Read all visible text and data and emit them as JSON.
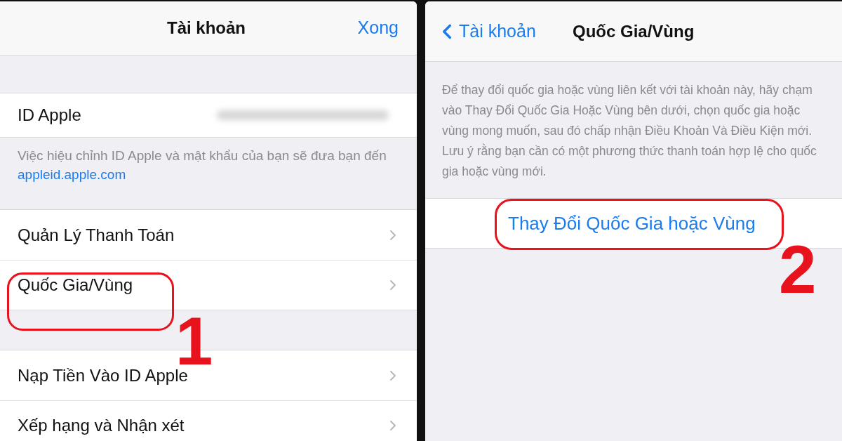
{
  "left_screen": {
    "nav": {
      "title": "Tài khoản",
      "action": "Xong"
    },
    "apple_id": {
      "label": "ID Apple"
    },
    "apple_id_note": {
      "text": "Việc hiệu chỉnh ID Apple và mật khẩu của bạn sẽ đưa bạn đến ",
      "link": "appleid.apple.com"
    },
    "groups": [
      [
        {
          "label": "Quản Lý Thanh Toán"
        },
        {
          "label": "Quốc Gia/Vùng"
        }
      ],
      [
        {
          "label": "Nạp Tiền Vào ID Apple"
        },
        {
          "label": "Xếp hạng và Nhận xét"
        }
      ]
    ]
  },
  "right_screen": {
    "nav": {
      "back": "Tài khoản",
      "title": "Quốc Gia/Vùng"
    },
    "description": "Để thay đổi quốc gia hoặc vùng liên kết với tài khoản này, hãy chạm vào Thay Đổi Quốc Gia Hoặc Vùng bên dưới, chọn quốc gia hoặc vùng mong muốn, sau đó chấp nhận Điều Khoản Và Điều Kiện mới. Lưu ý rằng bạn cần có một phương thức thanh toán hợp lệ cho quốc gia hoặc vùng mới.",
    "action": "Thay Đổi Quốc Gia hoặc Vùng"
  },
  "annotations": [
    {
      "label": "1"
    },
    {
      "label": "2"
    }
  ]
}
